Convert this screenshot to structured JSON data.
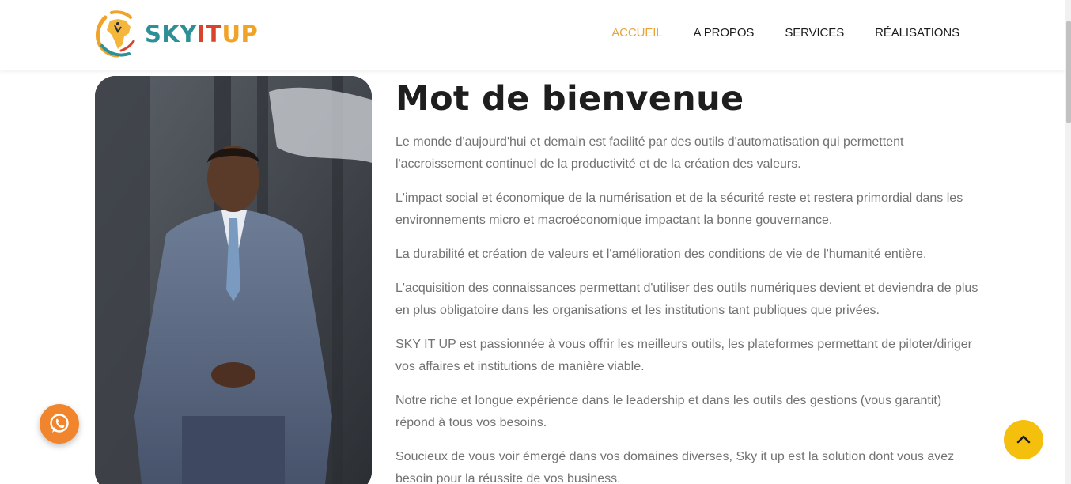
{
  "brand": {
    "part1": "SKY",
    "part2": "IT",
    "part3": "UP",
    "colors": {
      "teal": "#2e8f97",
      "red": "#d8442b",
      "orange": "#f0a326"
    }
  },
  "nav": {
    "items": [
      {
        "label": "ACCUEIL",
        "active": true
      },
      {
        "label": "A PROPOS",
        "active": false
      },
      {
        "label": "SERVICES",
        "active": false
      },
      {
        "label": "RÉALISATIONS",
        "active": false
      }
    ],
    "active_color": "#e8a33a"
  },
  "main": {
    "title": "Mot de bienvenue",
    "paragraphs": [
      "Le monde d'aujourd'hui et demain est facilité par des outils d'automatisation qui permettent l'accroissement continuel de la productivité et de la création des valeurs.",
      "L'impact social et économique de la numérisation et de la sécurité reste et restera primordial dans les environnements micro et macroéconomique impactant la bonne gouvernance.",
      "La durabilité et création de valeurs et l'amélioration des conditions de vie de l'humanité entière.",
      "L'acquisition des connaissances permettant d'utiliser des outils numériques devient et deviendra de plus en plus obligatoire dans les organisations et les institutions tant publiques que privées.",
      "SKY IT UP est passionnée à vous offrir les meilleurs outils, les plateformes permettant de piloter/diriger vos affaires et institutions de manière viable.",
      "Notre riche et longue expérience dans le leadership et dans les outils des gestions (vous garantit) répond à tous vos besoins.",
      "Soucieux de vous voir émergé dans vos domaines diverses, Sky it up est la solution dont vous avez besoin pour la réussite de vos business."
    ]
  },
  "floating": {
    "whatsapp_icon": "whatsapp-icon",
    "scroll_top_icon": "chevron-up-icon",
    "whatsapp_color": "#f0852d",
    "scroll_top_color": "#f5c00d"
  }
}
